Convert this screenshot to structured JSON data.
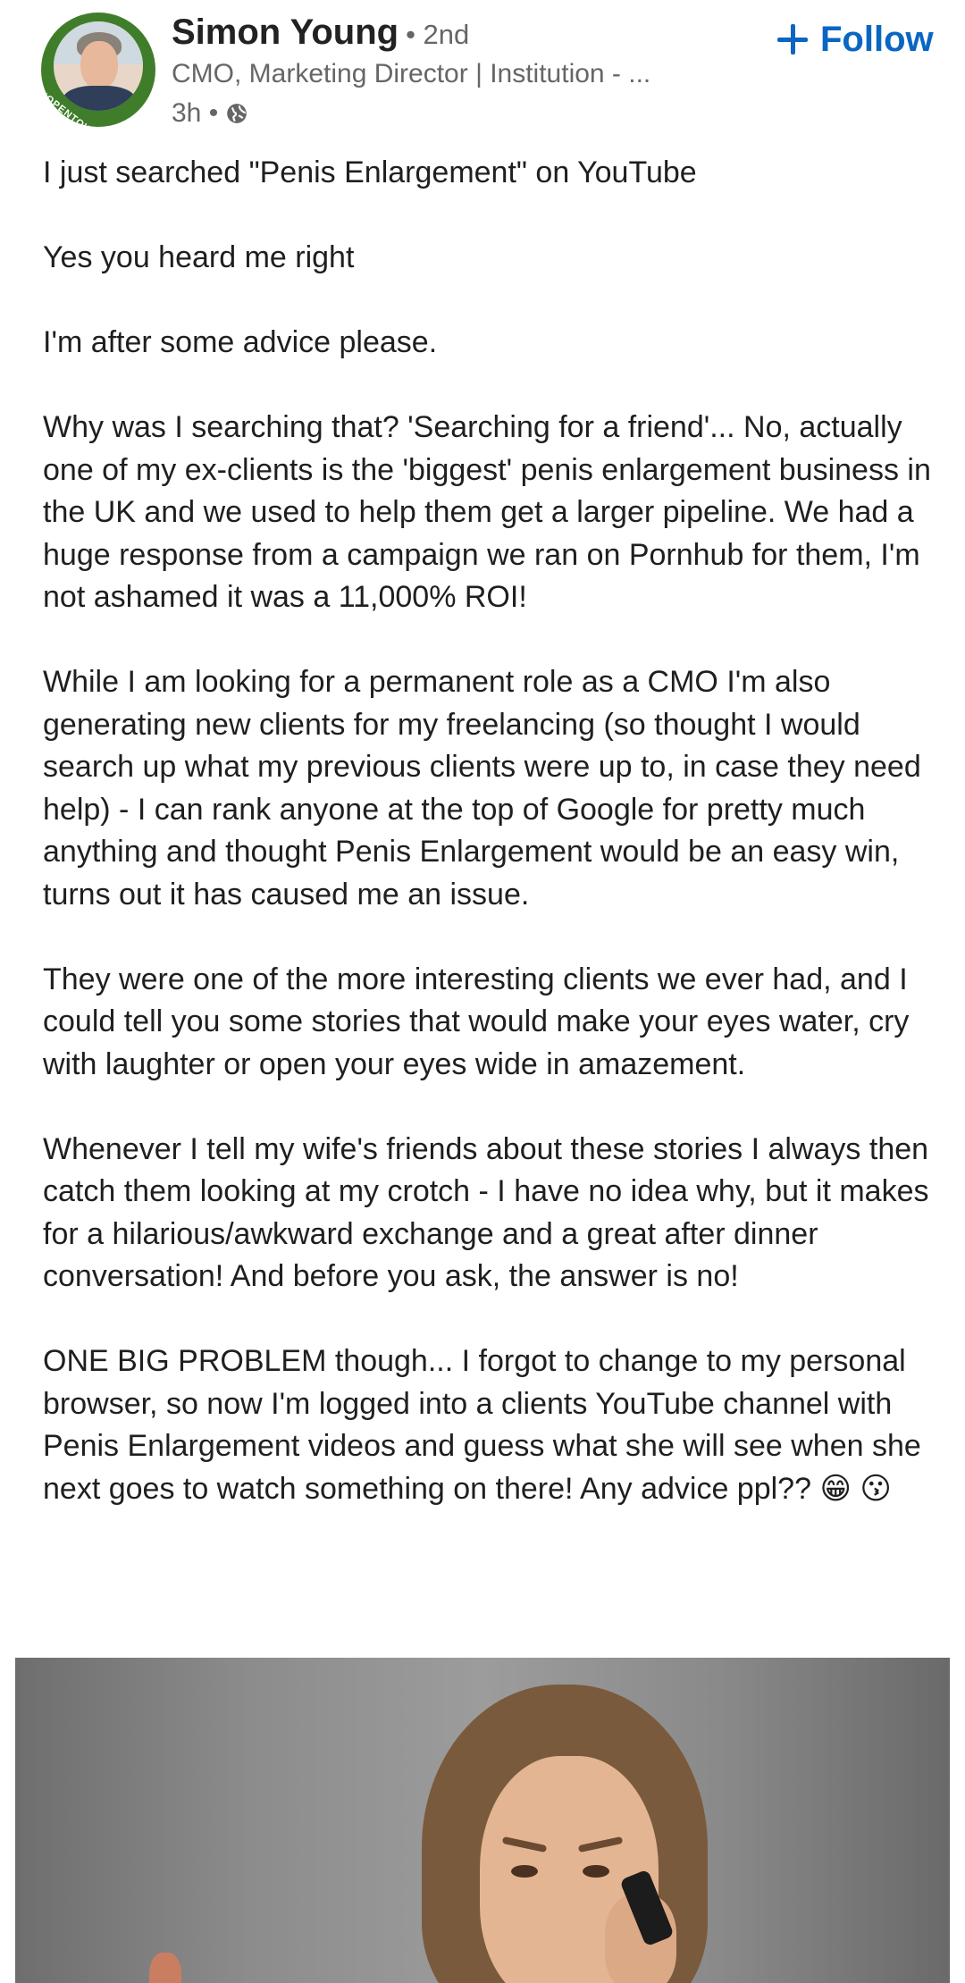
{
  "author": {
    "name": "Simon Young",
    "degree": "• 2nd",
    "headline": "CMO, Marketing Director | Institution - ...",
    "time": "3h •",
    "avatar_badge": "#OPENTOWORK"
  },
  "follow_button": {
    "label": "Follow"
  },
  "post": {
    "paragraphs": [
      "I just searched \"Penis Enlargement\" on YouTube",
      "Yes you heard me right",
      "I'm after some advice please.",
      "Why was I searching that? 'Searching for a friend'... No, actually one of my ex-clients is the 'biggest' penis enlargement business in the UK and we used to help them get a larger pipeline. We had a huge response from a campaign we ran on Pornhub for them, I'm not ashamed it was a 11,000% ROI!",
      "While I am looking for a permanent role as a CMO I'm also generating new clients for my freelancing (so thought I would search up what my previous clients were up to, in case they need help) - I can rank anyone at the top of Google for pretty much anything and thought Penis Enlargement would be an easy win, turns out it has caused me an issue.",
      "They were one of the more interesting clients we ever had, and I could tell you some stories that would make your eyes water, cry with laughter or open your eyes wide in amazement.",
      "Whenever I tell my wife's friends about these stories I always then catch them looking at my crotch - I have no idea why, but it makes for a hilarious/awkward exchange and a great after dinner conversation! And before you ask, the answer is no!",
      "ONE BIG PROBLEM though... I forgot to change to my personal browser, so now I'm logged into a clients YouTube channel with Penis Enlargement videos and guess what she will see when she next goes to watch something on there! Any advice ppl?? 😁 😗"
    ]
  },
  "icons": {
    "visibility": "globe-icon",
    "follow": "plus-icon"
  },
  "colors": {
    "accent": "#0a66c2",
    "text": "#1f1f1f",
    "secondary_text": "#666666",
    "badge_green": "#3f7d2a"
  }
}
